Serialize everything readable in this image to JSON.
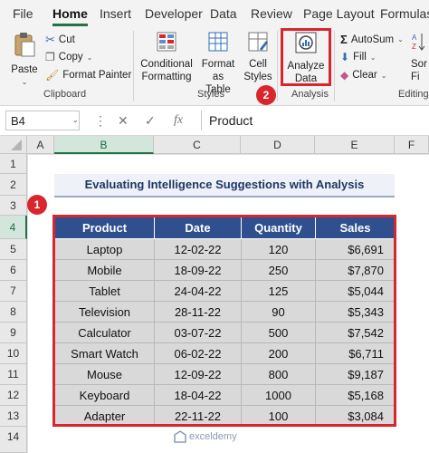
{
  "menu": {
    "tabs": [
      "File",
      "Home",
      "Insert",
      "Developer",
      "Data",
      "Review",
      "Page Layout",
      "Formulas"
    ],
    "active": "Home"
  },
  "ribbon": {
    "clipboard": {
      "paste": "Paste",
      "cut": "Cut",
      "copy": "Copy",
      "format_painter": "Format Painter",
      "group": "Clipboard"
    },
    "styles": {
      "conditional_1": "Conditional",
      "conditional_2": "Formatting",
      "format_table_1": "Format as",
      "format_table_2": "Table",
      "cell_styles_1": "Cell",
      "cell_styles_2": "Styles",
      "group": "Styles"
    },
    "analysis": {
      "analyze_1": "Analyze",
      "analyze_2": "Data",
      "group": "Analysis"
    },
    "editing": {
      "autosum": "AutoSum",
      "fill": "Fill",
      "clear": "Clear",
      "sort": "Sor",
      "sort_2": "Fi",
      "group": "Editing"
    }
  },
  "badges": {
    "one": "1",
    "two": "2"
  },
  "formula_bar": {
    "name_box": "B4",
    "fx": "fx",
    "value": "Product"
  },
  "columns": [
    "A",
    "B",
    "C",
    "D",
    "E",
    "F"
  ],
  "rows": [
    "1",
    "2",
    "3",
    "4",
    "5",
    "6",
    "7",
    "8",
    "9",
    "10",
    "11",
    "12",
    "13",
    "14"
  ],
  "sheet": {
    "title": "Evaluating Intelligence Suggestions with Analysis",
    "headers": [
      "Product",
      "Date",
      "Quantity",
      "Sales"
    ],
    "rows": [
      [
        "Laptop",
        "12-02-22",
        "120",
        "$6,691"
      ],
      [
        "Mobile",
        "18-09-22",
        "250",
        "$7,870"
      ],
      [
        "Tablet",
        "24-04-22",
        "125",
        "$5,044"
      ],
      [
        "Television",
        "28-11-22",
        "90",
        "$5,343"
      ],
      [
        "Calculator",
        "03-07-22",
        "500",
        "$7,542"
      ],
      [
        "Smart Watch",
        "06-02-22",
        "200",
        "$6,711"
      ],
      [
        "Mouse",
        "12-09-22",
        "800",
        "$9,187"
      ],
      [
        "Keyboard",
        "18-04-22",
        "1000",
        "$5,168"
      ],
      [
        "Adapter",
        "22-11-22",
        "100",
        "$3,084"
      ]
    ]
  },
  "watermark": "exceldemy",
  "colors": {
    "accent": "#217346",
    "highlight": "#d9262e",
    "header_bg": "#2f4f8f",
    "cell_bg": "#d9d9d9"
  }
}
